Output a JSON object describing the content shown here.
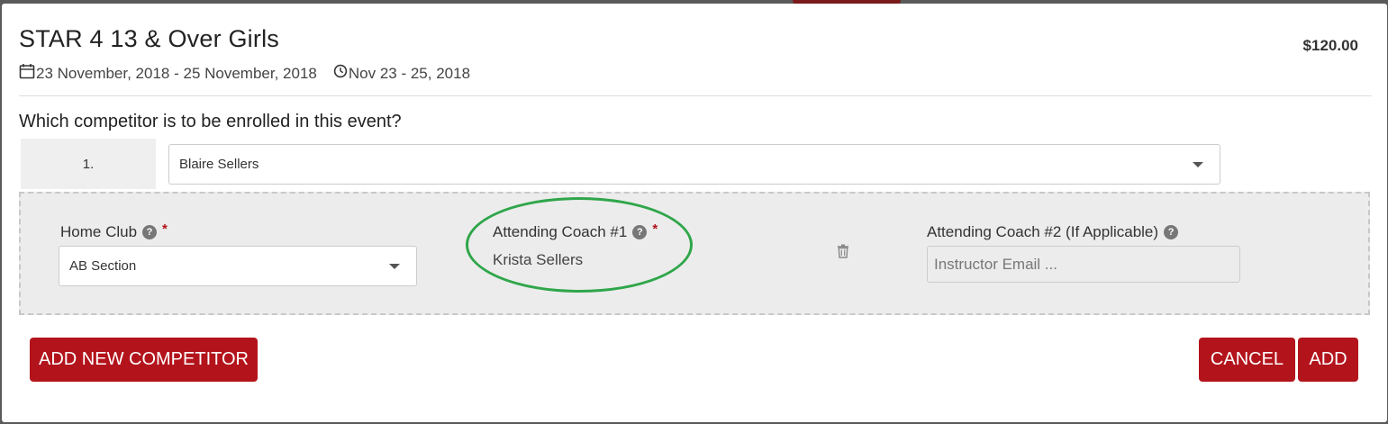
{
  "event": {
    "title": "STAR 4 13 & Over Girls",
    "price": "$120.00",
    "date_range": "23 November, 2018 - 25 November, 2018",
    "short_date_range": "Nov 23 - 25, 2018"
  },
  "form": {
    "question": "Which competitor is to be enrolled in this event?",
    "competitor_number": "1.",
    "competitor_selected": "Blaire Sellers",
    "home_club": {
      "label": "Home Club",
      "help_glyph": "?",
      "required_mark": "*",
      "selected": "AB Section"
    },
    "coach1": {
      "label": "Attending Coach #1",
      "help_glyph": "?",
      "required_mark": "*",
      "value": "Krista Sellers"
    },
    "coach2": {
      "label": "Attending Coach #2 (If Applicable)",
      "help_glyph": "?",
      "placeholder": "Instructor Email ..."
    }
  },
  "buttons": {
    "add_new_competitor": "ADD NEW COMPETITOR",
    "cancel": "CANCEL",
    "add": "ADD"
  },
  "colors": {
    "accent": "#b3141c",
    "annotation_circle": "#2fa64a",
    "panel_background": "#ececec"
  },
  "icons": {
    "date_icon": "calendar-icon",
    "time_icon": "clock-icon",
    "help_icon": "question-circle-icon",
    "delete_icon": "trash-icon",
    "dropdown_icon": "caret-down-icon"
  }
}
